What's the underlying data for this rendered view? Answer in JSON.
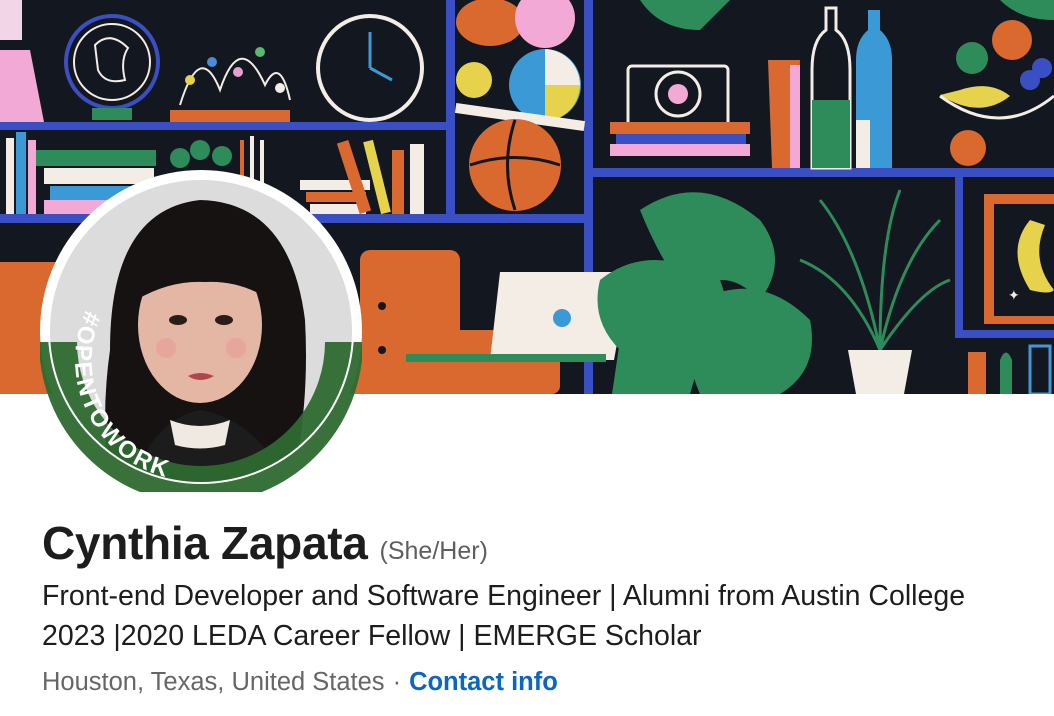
{
  "profile": {
    "name": "Cynthia Zapata",
    "pronouns": "(She/Her)",
    "headline": "Front-end Developer and Software Engineer | Alumni from Austin College 2023 |2020 LEDA Career Fellow | EMERGE Scholar",
    "location": "Houston, Texas, United States",
    "separator": "·",
    "contact_label": "Contact info",
    "badge_text": "#OPENTOWORK"
  },
  "colors": {
    "brand_link": "#0a66c2",
    "badge_green": "#2d6a2f",
    "banner_bg": "#13171f",
    "shelf_blue": "#3b4fc4"
  },
  "icons": {
    "cover_illustration": "bookshelf-illustration",
    "avatar": "profile-photo"
  }
}
